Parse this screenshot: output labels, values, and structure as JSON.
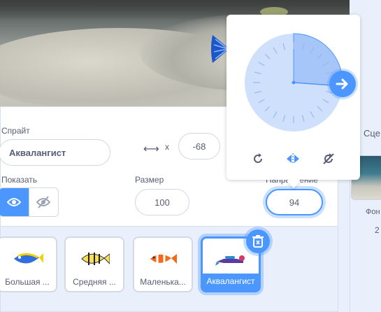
{
  "stage": {
    "description_icon": "fish-tail"
  },
  "sprite_info": {
    "sprite_label": "Спрайт",
    "sprite_name": "Аквалангист",
    "x_label": "x",
    "x_value": "-68",
    "show_label": "Показать",
    "size_label": "Размер",
    "size_value": "100",
    "direction_label": "Направление",
    "direction_value": "94"
  },
  "direction_popover": {
    "tools": [
      "rotate-all-around-icon",
      "left-right-icon",
      "dont-rotate-icon"
    ]
  },
  "sprites": [
    {
      "name": "Большая ...",
      "icon": "big-fish-icon",
      "selected": false
    },
    {
      "name": "Средняя ...",
      "icon": "medium-fish-icon",
      "selected": false
    },
    {
      "name": "Маленька...",
      "icon": "small-fish-icon",
      "selected": false
    },
    {
      "name": "Аквалангист",
      "icon": "diver-icon",
      "selected": true
    }
  ],
  "stage_pane": {
    "label": "Сце",
    "backdrops_label": "Фон",
    "backdrops_count": "2"
  },
  "colors": {
    "accent": "#4c97ff",
    "text": "#575e75",
    "panel_bg": "#e9f0fb"
  }
}
